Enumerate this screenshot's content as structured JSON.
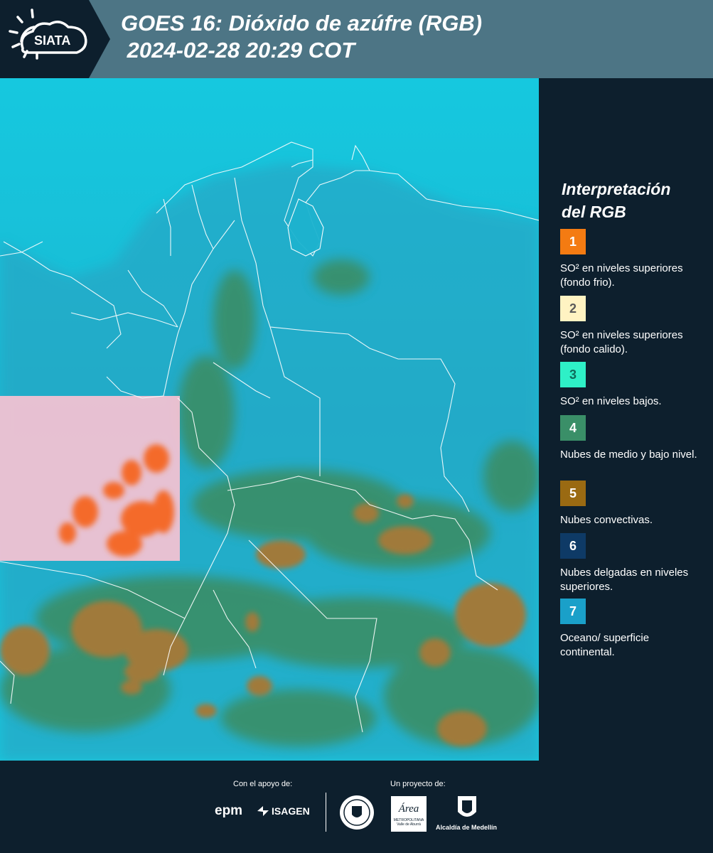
{
  "header": {
    "logo_text": "SIATA",
    "title_line1": "GOES 16: Dióxido de azúfre (RGB)",
    "title_line2": " 2024-02-28 20:29 COT"
  },
  "legend": {
    "title_line1": "Interpretación",
    "title_line2": "del RGB",
    "items": [
      {
        "number": "1",
        "color": "#f47b12",
        "text_color": "#ffffff",
        "label": "SO² en niveles superiores (fondo frio)."
      },
      {
        "number": "2",
        "color": "#fff3c2",
        "text_color": "#5a5a5a",
        "label": "SO² en niveles superiores (fondo calido)."
      },
      {
        "number": "3",
        "color": "#2ef0c7",
        "text_color": "#0f6b5a",
        "label": "SO² en niveles bajos."
      },
      {
        "number": "4",
        "color": "#3a8f68",
        "text_color": "#ffffff",
        "label": "Nubes de medio y bajo nivel."
      },
      {
        "number": "5",
        "color": "#9a6a12",
        "text_color": "#ffffff",
        "label": "Nubes convectivas."
      },
      {
        "number": "6",
        "color": "#0e3a66",
        "text_color": "#ffffff",
        "label": "Nubes delgadas en niveles superiores."
      },
      {
        "number": "7",
        "color": "#1aa0c9",
        "text_color": "#ffffff",
        "label": "Oceano/ superficie continental."
      }
    ]
  },
  "footer": {
    "support_label": "Con el apoyo de:",
    "project_label": "Un proyecto de:",
    "epm": "epm",
    "isagen": "ISAGEN",
    "area_name": "Área",
    "area_sub": "METROPOLITANA",
    "area_sub2": "Valle de Aburrá",
    "alcaldia": "Alcaldía de Medellín"
  },
  "map": {
    "ocean_color": "#18c6dd",
    "land_tint": "#2aa9c0",
    "cloud_mid_color": "#3d8a5a",
    "convective_color": "#a07a3a",
    "so2_color": "#f46a2a",
    "so2_box_color": "#f8c2d2"
  }
}
